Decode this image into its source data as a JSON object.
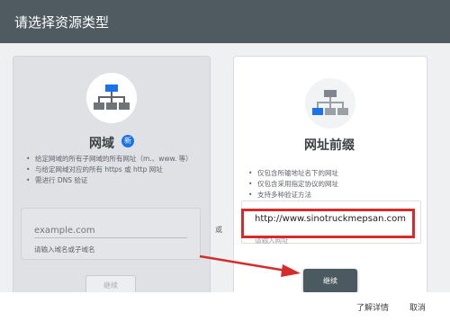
{
  "dialog": {
    "title": "请选择资源类型"
  },
  "domain_card": {
    "icon": "sitemap-icon",
    "title": "网域",
    "badge": "新",
    "bullets": [
      "给定网域的所有子网域的所有网址（m.、www. 等）",
      "与给定网域对应的所有 https 或 http 网址",
      "需进行 DNS 验证"
    ],
    "input_placeholder": "example.com",
    "helper": "请输入域名或子域名",
    "button": "继续"
  },
  "separator": "或",
  "url_prefix_card": {
    "icon": "sitemap-icon",
    "title": "网址前缀",
    "bullets": [
      "仅包含所输地址名下的网址",
      "仅包含采用指定协议的网址",
      "支持多种验证方法"
    ],
    "input_value": "http://www.sinotruckmepsan.com",
    "helper": "请输入网址",
    "button": "继续"
  },
  "footer": {
    "learn_more": "了解详情",
    "cancel": "取消"
  },
  "colors": {
    "header": "#4f5b61",
    "accent": "#1a73e8",
    "highlight": "#d52b2b"
  }
}
